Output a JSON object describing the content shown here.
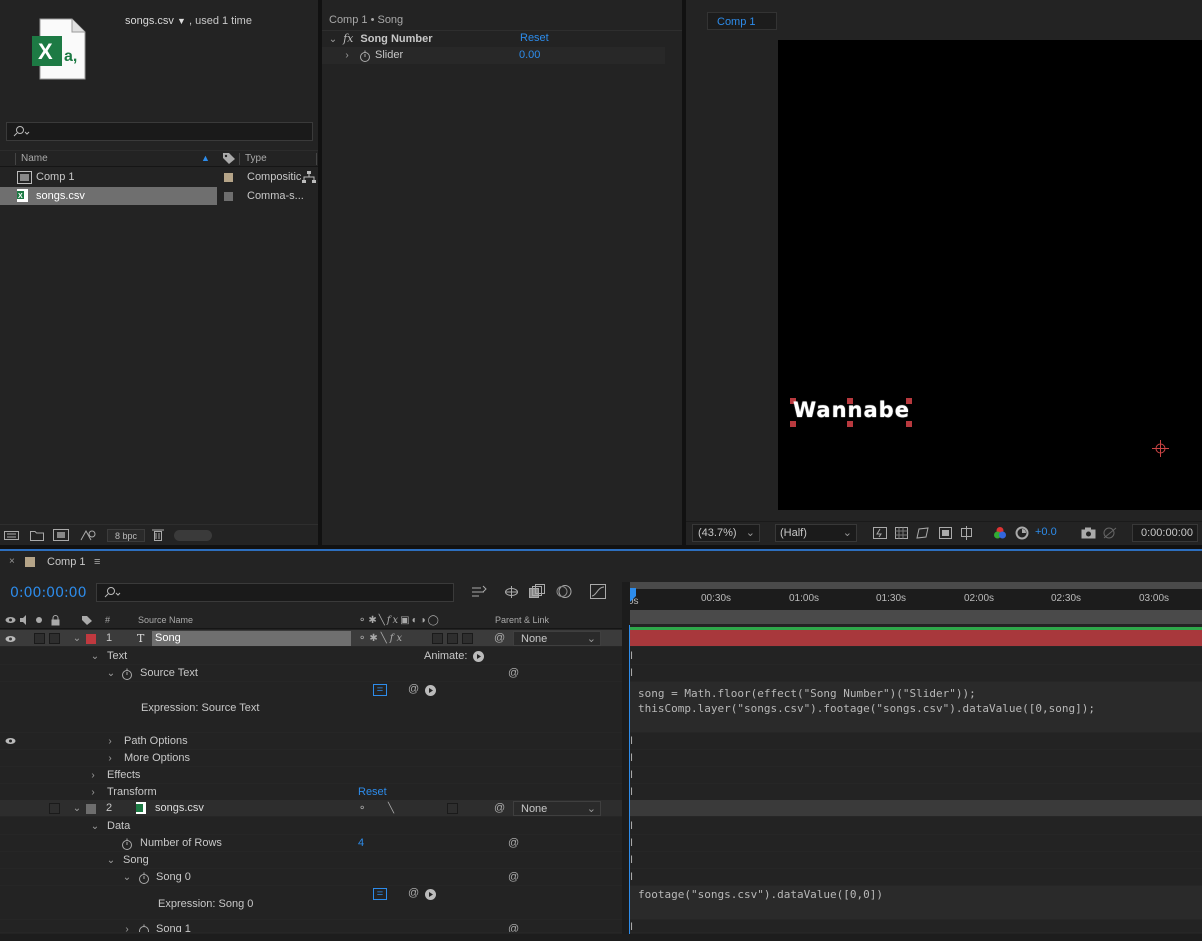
{
  "project": {
    "footage_name": "songs.csv",
    "usage": ", used 1 time",
    "search_placeholder": "",
    "columns": {
      "name": "Name",
      "type": "Type"
    },
    "items": [
      {
        "name": "Comp 1",
        "type": "Compositic",
        "label_color": "#b5a488"
      },
      {
        "name": "songs.csv",
        "type": "Comma-s...",
        "label_color": "#6e6e6e"
      }
    ],
    "bpc": "8 bpc"
  },
  "effects": {
    "breadcrumb": "Comp 1 • Song",
    "effect_name": "Song Number",
    "reset": "Reset",
    "param_name": "Slider",
    "param_value": "0.00"
  },
  "viewer": {
    "tab": "Comp 1",
    "canvas_text": "Wannabe",
    "zoom": "(43.7%)",
    "resolution": "(Half)",
    "exposure": "+0.0",
    "timecode": "0:00:00:00"
  },
  "timeline": {
    "tab": "Comp 1",
    "timecode": "0:00:00:00",
    "columns": {
      "number": "#",
      "source_name": "Source Name",
      "parent": "Parent & Link"
    },
    "ruler": [
      "0s",
      "00:30s",
      "01:00s",
      "01:30s",
      "02:00s",
      "02:30s",
      "03:00s"
    ],
    "layer1": {
      "number": "1",
      "name": "Song",
      "parent": "None",
      "color": "#c0393f"
    },
    "text_group": "Text",
    "animate": "Animate:",
    "source_text": "Source Text",
    "expression_label_1": "Expression: Source Text",
    "expression_line_1": "song = Math.floor(effect(\"Song Number\")(\"Slider\"));",
    "expression_line_2": "thisComp.layer(\"songs.csv\").footage(\"songs.csv\").dataValue([0,song]);",
    "path_options": "Path Options",
    "more_options": "More Options",
    "effects_group": "Effects",
    "transform": "Transform",
    "transform_reset": "Reset",
    "layer2": {
      "number": "2",
      "name": "songs.csv",
      "parent": "None",
      "color": "#6e6e6e"
    },
    "data_group": "Data",
    "rows_label": "Number of Rows",
    "rows_value": "4",
    "song_group": "Song",
    "song0": "Song 0",
    "expression_label_2": "Expression: Song 0",
    "expression_line_3": "footage(\"songs.csv\").dataValue([0,0])",
    "song1": "Song 1"
  }
}
